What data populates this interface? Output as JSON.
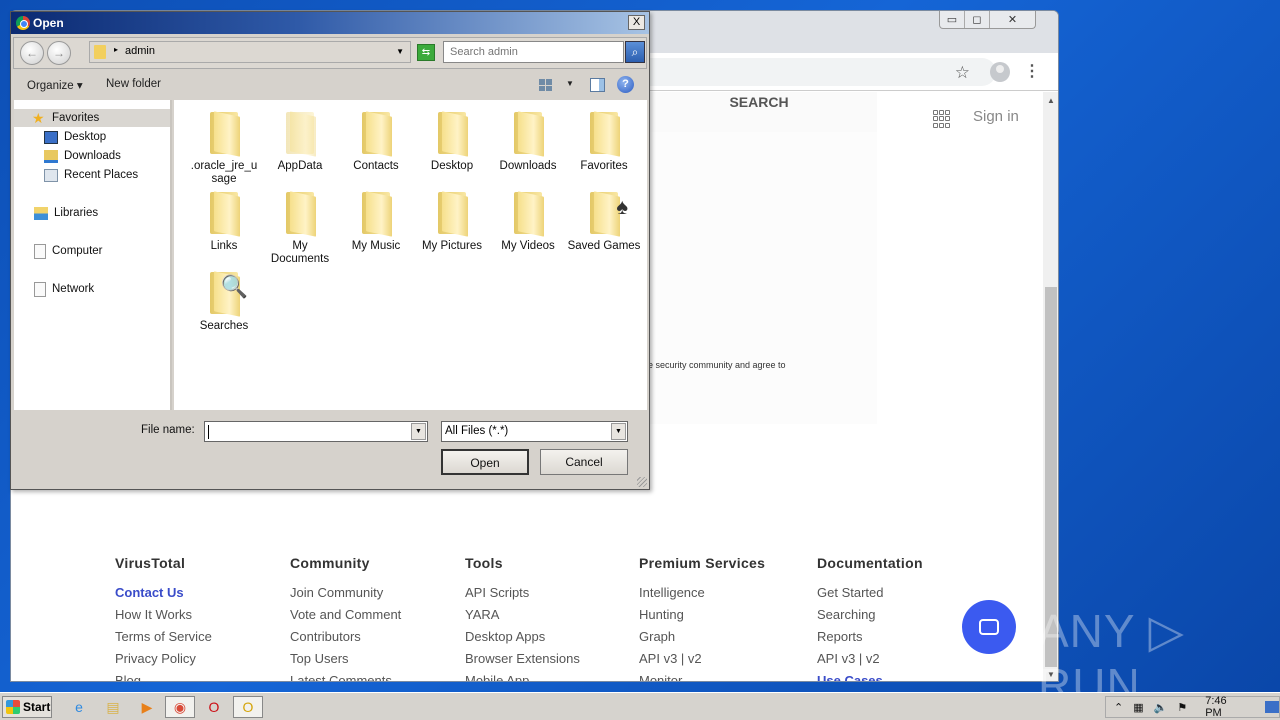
{
  "browser": {
    "window_controls": {
      "minimize": "▭",
      "restore": "◻",
      "close": "✕"
    },
    "page": {
      "search_tab": "SEARCH",
      "sign_in": "Sign in",
      "consent_text": "e security community and agree to",
      "footer": [
        {
          "heading": "VirusTotal",
          "links": [
            "Contact Us",
            "How It Works",
            "Terms of Service",
            "Privacy Policy",
            "Blog"
          ],
          "highlight": [
            0
          ]
        },
        {
          "heading": "Community",
          "links": [
            "Join Community",
            "Vote and Comment",
            "Contributors",
            "Top Users",
            "Latest Comments"
          ],
          "highlight": []
        },
        {
          "heading": "Tools",
          "links": [
            "API Scripts",
            "YARA",
            "Desktop Apps",
            "Browser Extensions",
            "Mobile App"
          ],
          "highlight": []
        },
        {
          "heading": "Premium Services",
          "links": [
            "Intelligence",
            "Hunting",
            "Graph",
            "API v3 | v2",
            "Monitor"
          ],
          "highlight": []
        },
        {
          "heading": "Documentation",
          "links": [
            "Get Started",
            "Searching",
            "Reports",
            "API v3 | v2",
            "Use Cases"
          ],
          "highlight": [
            4
          ]
        }
      ]
    },
    "icons": {
      "star": "☆",
      "kebab": "⋮",
      "scroll_up": "▲",
      "scroll_down": "▼"
    }
  },
  "dialog": {
    "title": "Open",
    "close": "X",
    "address": {
      "arrow": "▸",
      "value": "admin",
      "dropdown": "▼"
    },
    "search_placeholder": "Search admin",
    "toolbar": {
      "organize": "Organize ▾",
      "new_folder": "New folder",
      "view_dropdown": "▼",
      "help": "?"
    },
    "nav_back": "←",
    "nav_forward": "→",
    "refresh": "⇆",
    "search_glyph": "⌕",
    "nav_pane": [
      {
        "label": "Favorites",
        "icon": "star-icon",
        "level": 0,
        "selected": true
      },
      {
        "label": "Desktop",
        "icon": "desktop-icon",
        "level": 1
      },
      {
        "label": "Downloads",
        "icon": "downloads-icon",
        "level": 1
      },
      {
        "label": "Recent Places",
        "icon": "recent-places-icon",
        "level": 1
      },
      {
        "label": "Libraries",
        "icon": "libraries-icon",
        "level": 0
      },
      {
        "label": "Computer",
        "icon": "computer-icon",
        "level": 0
      },
      {
        "label": "Network",
        "icon": "network-icon",
        "level": 0
      }
    ],
    "files": [
      {
        "name": ".oracle_jre_usage",
        "display": ".oracle_jre_u sage"
      },
      {
        "name": "AppData",
        "display": "AppData",
        "hidden": true
      },
      {
        "name": "Contacts",
        "display": "Contacts"
      },
      {
        "name": "Desktop",
        "display": "Desktop"
      },
      {
        "name": "Downloads",
        "display": "Downloads"
      },
      {
        "name": "Favorites",
        "display": "Favorites"
      },
      {
        "name": "Links",
        "display": "Links"
      },
      {
        "name": "My Documents",
        "display": "My Documents"
      },
      {
        "name": "My Music",
        "display": "My Music"
      },
      {
        "name": "My Pictures",
        "display": "My Pictures"
      },
      {
        "name": "My Videos",
        "display": "My Videos"
      },
      {
        "name": "Saved Games",
        "display": "Saved Games",
        "overlay": "♠"
      },
      {
        "name": "Searches",
        "display": "Searches",
        "overlay": "🔍"
      }
    ],
    "file_name_label": "File name:",
    "file_name_value": "",
    "file_type": "All Files (*.*)",
    "dropdown_glyph": "▼",
    "open_label": "Open",
    "cancel_label": "Cancel"
  },
  "watermark": "ANY ▷ RUN",
  "taskbar": {
    "start_label": "Start",
    "apps": [
      {
        "name": "internet-explorer",
        "glyph": "e",
        "color": "#2f8ae0"
      },
      {
        "name": "file-explorer",
        "glyph": "▤",
        "color": "#d8b24a"
      },
      {
        "name": "media-player",
        "glyph": "▶",
        "color": "#e8801a"
      },
      {
        "name": "chrome",
        "glyph": "◉",
        "color": "#d94a38",
        "active": true
      },
      {
        "name": "opera",
        "glyph": "O",
        "color": "#cc0f16"
      },
      {
        "name": "outlook-app",
        "glyph": "O",
        "color": "#d4a40a"
      }
    ],
    "tray": {
      "expand": "⌃",
      "network": "▦",
      "volume": "🔈",
      "flag": "⚑",
      "clock": "7:46 PM"
    }
  }
}
